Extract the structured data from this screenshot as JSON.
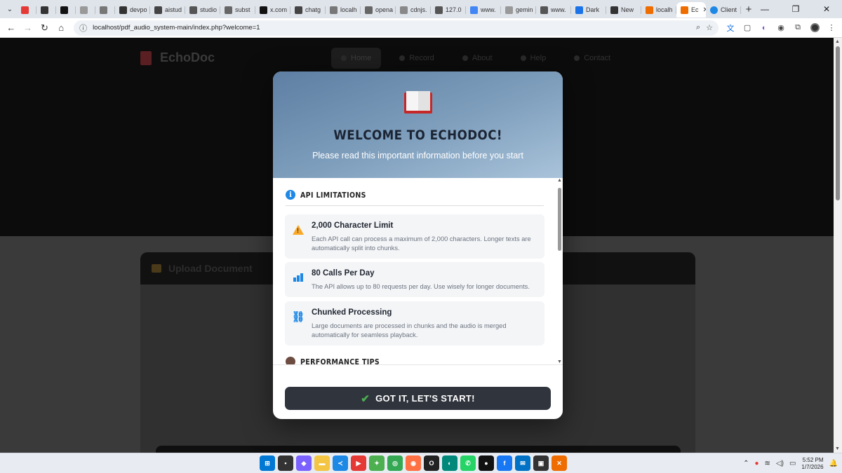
{
  "browser": {
    "tabs": [
      {
        "label": "",
        "color": "#e53935"
      },
      {
        "label": "",
        "color": "#333333"
      },
      {
        "label": "",
        "color": "#111111"
      },
      {
        "label": "",
        "color": "#999999"
      },
      {
        "label": "",
        "color": "#777777"
      },
      {
        "label": "devpo",
        "color": "#333333"
      },
      {
        "label": "aistud",
        "color": "#444444"
      },
      {
        "label": "studio",
        "color": "#555555"
      },
      {
        "label": "subst",
        "color": "#666666"
      },
      {
        "label": "x.com",
        "color": "#111111"
      },
      {
        "label": "chatg",
        "color": "#444444"
      },
      {
        "label": "localh",
        "color": "#777777"
      },
      {
        "label": "opena",
        "color": "#666666"
      },
      {
        "label": "cdnjs.",
        "color": "#888888"
      },
      {
        "label": "127.0",
        "color": "#555555"
      },
      {
        "label": "www.",
        "color": "#4285f4"
      },
      {
        "label": "gemin",
        "color": "#999999"
      },
      {
        "label": "www.",
        "color": "#555555"
      },
      {
        "label": "Dark",
        "color": "#1a73e8"
      },
      {
        "label": "New",
        "color": "#333333"
      },
      {
        "label": "localh",
        "color": "#ef6c00"
      }
    ],
    "active_tab": {
      "label": "Ec",
      "color": "#ef6c00"
    },
    "after_tab": {
      "label": "Client",
      "color": "#1e88e5"
    },
    "new_tab": "+",
    "url": "localhost/pdf_audio_system-main/index.php?welcome=1"
  },
  "page": {
    "brand": "EchoDoc",
    "nav": [
      "Home",
      "Record",
      "About",
      "Help",
      "Contact"
    ],
    "upload_title": "Upload Document"
  },
  "modal": {
    "title": "WELCOME TO ECHODOC!",
    "subtitle": "Please read this important information before you start",
    "section1": "API LIMITATIONS",
    "section2": "PERFORMANCE TIPS",
    "cards": [
      {
        "icon": "warning-icon",
        "title": "2,000 Character Limit",
        "text": "Each API call can process a maximum of 2,000 characters. Longer texts are automatically split into chunks."
      },
      {
        "icon": "bar-chart-icon",
        "title": "80 Calls Per Day",
        "text": "The API allows up to 80 requests per day. Use wisely for longer documents."
      },
      {
        "icon": "link-icon",
        "title": "Chunked Processing",
        "text": "Large documents are processed in chunks and the audio is merged automatically for seamless playback."
      }
    ],
    "button": "GOT IT, LET'S START!"
  },
  "taskbar": {
    "time": "5:52 PM",
    "date": "1/7/2026"
  },
  "colors": {
    "modal_header_start": "#5e7ea3",
    "modal_header_end": "#a9c3da",
    "button_bg": "#30343d",
    "check": "#4caf50",
    "info_blue": "#1e88e5",
    "warning": "#f9a825"
  }
}
